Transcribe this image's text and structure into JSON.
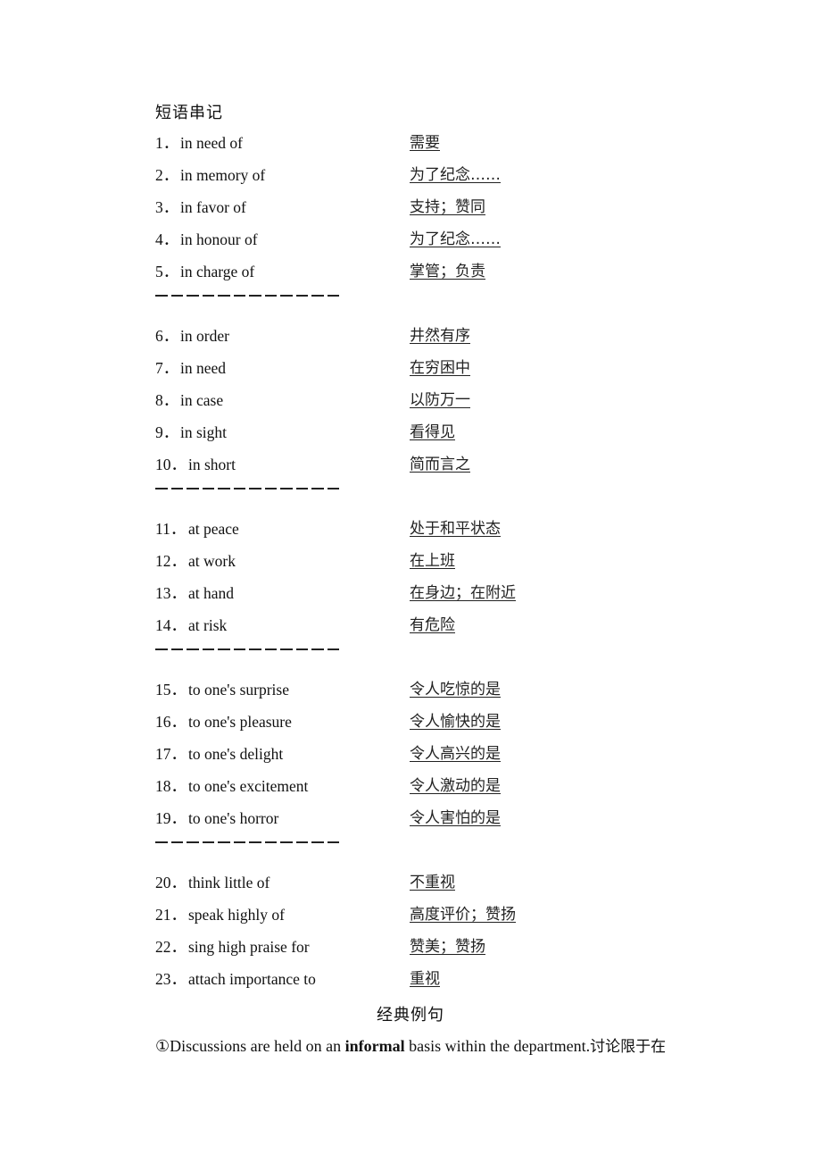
{
  "heading": "短语串记",
  "groups": [
    {
      "items": [
        {
          "num": "1．",
          "en": "in need of",
          "zh": "需要"
        },
        {
          "num": "2．",
          "en": "in memory of",
          "zh": "为了纪念……"
        },
        {
          "num": "3．",
          "en": "in favor of",
          "zh": "支持；赞同"
        },
        {
          "num": "4．",
          "en": "in honour of",
          "zh": "为了纪念……"
        },
        {
          "num": "5．",
          "en": "in charge of",
          "zh": "掌管；负责"
        }
      ]
    },
    {
      "items": [
        {
          "num": "6．",
          "en": "in order",
          "zh": "井然有序"
        },
        {
          "num": "7．",
          "en": "in need",
          "zh": "在穷困中"
        },
        {
          "num": "8．",
          "en": "in case",
          "zh": "以防万一"
        },
        {
          "num": "9．",
          "en": "in sight",
          "zh": "看得见"
        },
        {
          "num": "10．",
          "en": "in short",
          "zh": "简而言之"
        }
      ]
    },
    {
      "items": [
        {
          "num": "11．",
          "en": "at peace",
          "zh": "处于和平状态"
        },
        {
          "num": "12．",
          "en": "at work",
          "zh": "在上班"
        },
        {
          "num": "13．",
          "en": "at hand",
          "zh": "在身边；在附近"
        },
        {
          "num": "14．",
          "en": "at risk",
          "zh": "有危险"
        }
      ]
    },
    {
      "items": [
        {
          "num": "15．",
          "en": "to one's surprise",
          "zh": "令人吃惊的是"
        },
        {
          "num": "16．",
          "en": "to one's pleasure",
          "zh": "令人愉快的是"
        },
        {
          "num": "17．",
          "en": "to one's delight",
          "zh": "令人高兴的是"
        },
        {
          "num": "18．",
          "en": "to one's excitement",
          "zh": "令人激动的是"
        },
        {
          "num": "19．",
          "en": "to one's horror",
          "zh": "令人害怕的是"
        }
      ]
    },
    {
      "items": [
        {
          "num": "20．",
          "en": "think little of",
          "zh": "不重视"
        },
        {
          "num": "21．",
          "en": "speak highly of",
          "zh": "高度评价；赞扬"
        },
        {
          "num": "22．",
          "en": "sing high praise for",
          "zh": "赞美；赞扬"
        },
        {
          "num": "23．",
          "en": "attach importance to",
          "zh": "重视"
        }
      ]
    }
  ],
  "separator": "————————————",
  "subheading": "经典例句",
  "example": {
    "marker": "①",
    "before": "Discussions are held on an ",
    "bold": "informal",
    "after": " basis within the department.",
    "zh": "讨论限于在"
  }
}
